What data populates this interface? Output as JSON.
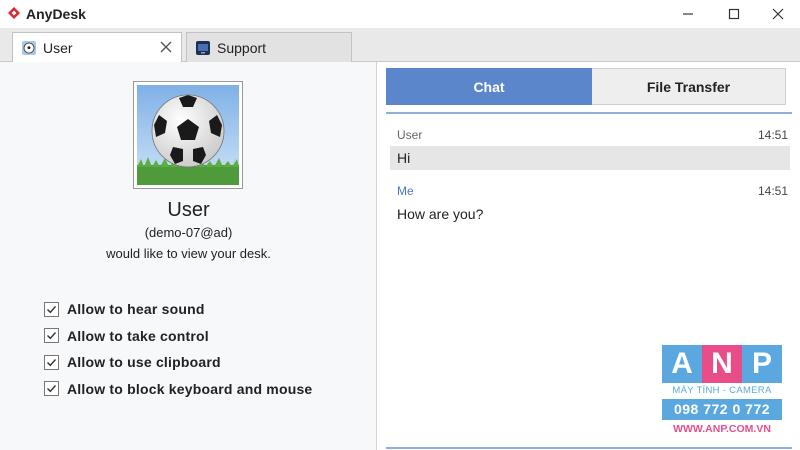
{
  "window": {
    "title": "AnyDesk",
    "logo_icon": "anydesk-diamond-logo",
    "controls": [
      "minimize-icon",
      "maximize-icon",
      "close-icon"
    ]
  },
  "tabs": [
    {
      "label": "User",
      "icon": "soccer-ball-avatar-icon",
      "active": true,
      "closable": true
    },
    {
      "label": "Support",
      "icon": "monitor-icon",
      "active": false,
      "closable": false
    }
  ],
  "request": {
    "name": "User",
    "id": "(demo-07@ad)",
    "message": "would like to view your desk.",
    "avatar": "soccer-ball-image",
    "permissions": [
      {
        "label": "Allow to hear sound",
        "checked": true
      },
      {
        "label": "Allow to take control",
        "checked": true
      },
      {
        "label": "Allow to use clipboard",
        "checked": true
      },
      {
        "label": "Allow to block keyboard and mouse",
        "checked": true
      }
    ]
  },
  "panel_tabs": {
    "chat": "Chat",
    "file_transfer": "File Transfer",
    "active": "chat"
  },
  "chat": {
    "messages": [
      {
        "sender": "User",
        "time": "14:51",
        "text": "Hi"
      },
      {
        "sender": "Me",
        "time": "14:51",
        "text": "How are you?"
      }
    ]
  },
  "watermark": {
    "letters": [
      "A",
      "N",
      "P"
    ],
    "subtitle": "MÁY TÍNH - CAMERA",
    "phone": "098 772 0 772",
    "website": "WWW.ANP.COM.VN"
  },
  "colors": {
    "accent_blue": "#5b86cc",
    "divider_blue": "#8fb0dd",
    "logo_red": "#e0262c",
    "me_sender": "#4a78c2",
    "watermark_blue": "#5aa8df",
    "watermark_pink": "#e84d8a"
  }
}
